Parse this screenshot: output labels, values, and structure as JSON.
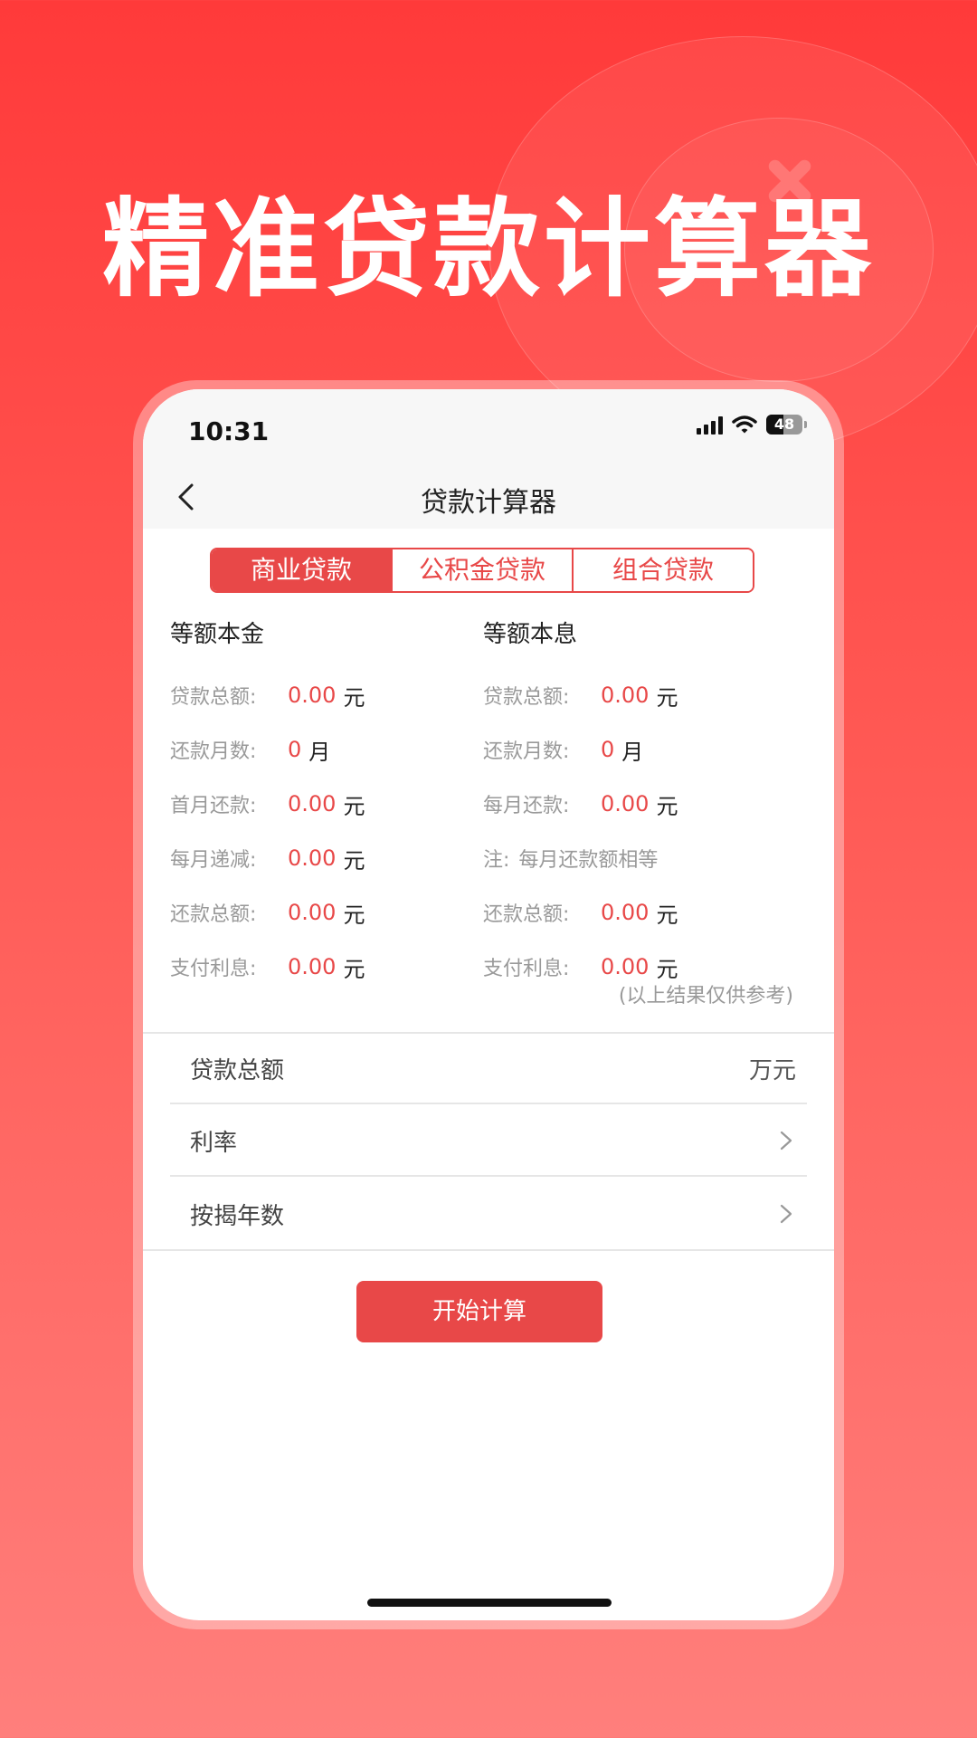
{
  "hero": {
    "title": "精准贷款计算器"
  },
  "status_bar": {
    "time": "10:31",
    "battery": "48",
    "battery_level": 0.48
  },
  "nav": {
    "title": "贷款计算器"
  },
  "tabs": [
    {
      "label": "商业贷款",
      "active": true
    },
    {
      "label": "公积金贷款",
      "active": false
    },
    {
      "label": "组合贷款",
      "active": false
    }
  ],
  "results": {
    "left": {
      "title": "等额本金",
      "rows": [
        {
          "label": "贷款总额:",
          "value": "0.00",
          "unit": "元"
        },
        {
          "label": "还款月数:",
          "value": "0",
          "unit": "月"
        },
        {
          "label": "首月还款:",
          "value": "0.00",
          "unit": "元"
        },
        {
          "label": "每月递减:",
          "value": "0.00",
          "unit": "元"
        },
        {
          "label": "还款总额:",
          "value": "0.00",
          "unit": "元"
        },
        {
          "label": "支付利息:",
          "value": "0.00",
          "unit": "元"
        }
      ]
    },
    "right": {
      "title": "等额本息",
      "rows": [
        {
          "label": "贷款总额:",
          "value": "0.00",
          "unit": "元"
        },
        {
          "label": "还款月数:",
          "value": "0",
          "unit": "月"
        },
        {
          "label": "每月还款:",
          "value": "0.00",
          "unit": "元"
        },
        {
          "label": "注:",
          "note": "每月还款额相等"
        },
        {
          "label": "还款总额:",
          "value": "0.00",
          "unit": "元"
        },
        {
          "label": "支付利息:",
          "value": "0.00",
          "unit": "元"
        }
      ]
    },
    "disclaimer": "(以上结果仅供参考)"
  },
  "form": {
    "loan_amount": {
      "label": "贷款总额",
      "unit": "万元"
    },
    "rate": {
      "label": "利率"
    },
    "years": {
      "label": "按揭年数"
    }
  },
  "calculate_button": {
    "label": "开始计算"
  },
  "colors": {
    "accent": "#e84848",
    "background_top": "#ff3a3a",
    "background_bottom": "#ff7f7c"
  }
}
